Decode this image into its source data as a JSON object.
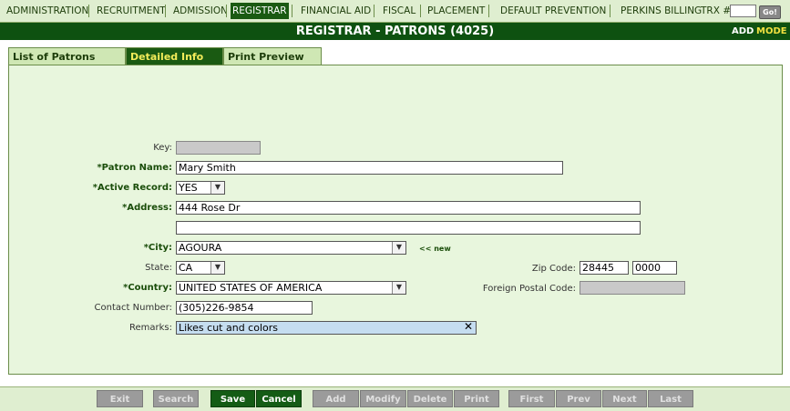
{
  "nav": {
    "items": [
      {
        "label": "ADMINISTRATION",
        "active": false
      },
      {
        "label": "RECRUITMENT",
        "active": false
      },
      {
        "label": "ADMISSION",
        "active": false
      },
      {
        "label": "REGISTRAR",
        "active": true
      },
      {
        "label": "FINANCIAL AID",
        "active": false
      },
      {
        "label": "FISCAL",
        "active": false
      },
      {
        "label": "PLACEMENT",
        "active": false
      },
      {
        "label": "DEFAULT PREVENTION",
        "active": false
      },
      {
        "label": "PERKINS BILLING",
        "active": false
      }
    ],
    "trx_label": "TRX #:",
    "trx_value": "",
    "go_label": "Go!"
  },
  "header": {
    "title": "REGISTRAR - PATRONS (4025)",
    "mode_value": "ADD",
    "mode_label": "MODE"
  },
  "tabs": [
    {
      "label": "List of Patrons",
      "active": false
    },
    {
      "label": "Detailed Info",
      "active": true
    },
    {
      "label": "Print Preview",
      "active": false
    }
  ],
  "form": {
    "key": {
      "label": "Key:",
      "value": ""
    },
    "patron_name": {
      "label": "*Patron Name:",
      "value": "Mary Smith"
    },
    "active_record": {
      "label": "*Active Record:",
      "value": "YES"
    },
    "address": {
      "label": "*Address:",
      "line1": "444 Rose Dr",
      "line2": ""
    },
    "city": {
      "label": "*City:",
      "value": "AGOURA",
      "new_link": "<< new"
    },
    "state": {
      "label": "State:",
      "value": "CA"
    },
    "country": {
      "label": "*Country:",
      "value": "UNITED STATES OF AMERICA"
    },
    "contact_number": {
      "label": "Contact Number:",
      "value": "(305)226-9854"
    },
    "remarks": {
      "label": "Remarks:",
      "value": "Likes cut and colors"
    },
    "zip_code": {
      "label": "Zip Code:",
      "value": "28445",
      "ext": "0000"
    },
    "foreign_postal_code": {
      "label": "Foreign Postal Code:",
      "value": ""
    }
  },
  "buttons": {
    "exit": "Exit",
    "search": "Search",
    "save": "Save",
    "cancel": "Cancel",
    "add": "Add",
    "modify": "Modify",
    "delete": "Delete",
    "print": "Print",
    "first": "First",
    "prev": "Prev",
    "next": "Next",
    "last": "Last"
  },
  "colors": {
    "nav_bg": "#dfeed0",
    "title_bg": "#0e5110",
    "active_tab_text": "#f3ec5a",
    "panel_bg": "#e8f6dd",
    "enabled_button": "#145c15",
    "disabled_button": "#9b9b9b"
  }
}
